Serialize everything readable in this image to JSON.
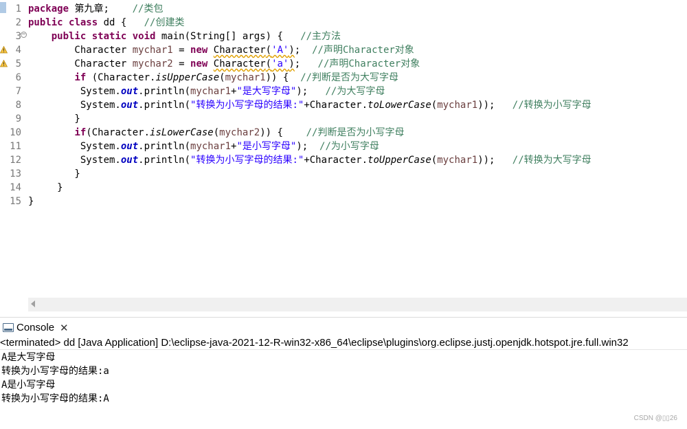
{
  "editor": {
    "line_numbers": [
      "1",
      "2",
      "3",
      "4",
      "5",
      "6",
      "7",
      "8",
      "9",
      "10",
      "11",
      "12",
      "13",
      "14",
      "15"
    ],
    "lines": [
      [
        {
          "c": "kw",
          "t": "package"
        },
        {
          "t": " 第九章;    "
        },
        {
          "c": "cm",
          "t": "//类包"
        }
      ],
      [
        {
          "c": "kw",
          "t": "public"
        },
        {
          "t": " "
        },
        {
          "c": "kw",
          "t": "class"
        },
        {
          "t": " dd {   "
        },
        {
          "c": "cm",
          "t": "//创建类"
        }
      ],
      [
        {
          "t": "    "
        },
        {
          "c": "kw",
          "t": "public"
        },
        {
          "t": " "
        },
        {
          "c": "kw",
          "t": "static"
        },
        {
          "t": " "
        },
        {
          "c": "kw",
          "t": "void"
        },
        {
          "t": " main(String[] args) {   "
        },
        {
          "c": "cm",
          "t": "//主方法"
        }
      ],
      [
        {
          "t": "        Character "
        },
        {
          "c": "va",
          "t": "mychar1"
        },
        {
          "t": " = "
        },
        {
          "c": "kw",
          "t": "new"
        },
        {
          "t": " "
        },
        {
          "c": "dep squig",
          "t": "Character"
        },
        {
          "c": "squig",
          "t": "("
        },
        {
          "c": "st squig",
          "t": "'A'"
        },
        {
          "c": "squig",
          "t": ")"
        },
        {
          "t": ";  "
        },
        {
          "c": "cm",
          "t": "//声明Character对象"
        }
      ],
      [
        {
          "t": "        Character "
        },
        {
          "c": "va",
          "t": "mychar2"
        },
        {
          "t": " = "
        },
        {
          "c": "kw",
          "t": "new"
        },
        {
          "t": " "
        },
        {
          "c": "dep squig",
          "t": "Character"
        },
        {
          "c": "squig",
          "t": "("
        },
        {
          "c": "st squig",
          "t": "'a'"
        },
        {
          "c": "squig",
          "t": ")"
        },
        {
          "t": ";   "
        },
        {
          "c": "cm",
          "t": "//声明Character对象"
        }
      ],
      [
        {
          "t": "        "
        },
        {
          "c": "kw",
          "t": "if"
        },
        {
          "t": " (Character."
        },
        {
          "c": "it",
          "t": "isUpperCase"
        },
        {
          "t": "("
        },
        {
          "c": "va",
          "t": "mychar1"
        },
        {
          "t": ")) {  "
        },
        {
          "c": "cm",
          "t": "//判断是否为大写字母"
        }
      ],
      [
        {
          "t": "         System."
        },
        {
          "c": "fd",
          "t": "out"
        },
        {
          "t": ".println("
        },
        {
          "c": "va",
          "t": "mychar1"
        },
        {
          "t": "+"
        },
        {
          "c": "st",
          "t": "\"是大写字母\""
        },
        {
          "t": ");   "
        },
        {
          "c": "cm",
          "t": "//为大写字母"
        }
      ],
      [
        {
          "t": "         System."
        },
        {
          "c": "fd",
          "t": "out"
        },
        {
          "t": ".println("
        },
        {
          "c": "st",
          "t": "\"转换为小写字母的结果:\""
        },
        {
          "t": "+Character."
        },
        {
          "c": "it",
          "t": "toLowerCase"
        },
        {
          "t": "("
        },
        {
          "c": "va",
          "t": "mychar1"
        },
        {
          "t": "));   "
        },
        {
          "c": "cm",
          "t": "//转换为小写字母"
        }
      ],
      [
        {
          "t": "        }"
        }
      ],
      [
        {
          "t": "        "
        },
        {
          "c": "kw",
          "t": "if"
        },
        {
          "t": "(Character."
        },
        {
          "c": "it",
          "t": "isLowerCase"
        },
        {
          "t": "("
        },
        {
          "c": "va",
          "t": "mychar2"
        },
        {
          "t": ")) {    "
        },
        {
          "c": "cm",
          "t": "//判断是否为小写字母"
        }
      ],
      [
        {
          "t": "         System."
        },
        {
          "c": "fd",
          "t": "out"
        },
        {
          "t": ".println("
        },
        {
          "c": "va",
          "t": "mychar1"
        },
        {
          "t": "+"
        },
        {
          "c": "st",
          "t": "\"是小写字母\""
        },
        {
          "t": ");  "
        },
        {
          "c": "cm",
          "t": "//为小写字母"
        }
      ],
      [
        {
          "t": "         System."
        },
        {
          "c": "fd",
          "t": "out"
        },
        {
          "t": ".println("
        },
        {
          "c": "st",
          "t": "\"转换为小写字母的结果:\""
        },
        {
          "t": "+Character."
        },
        {
          "c": "it",
          "t": "toUpperCase"
        },
        {
          "t": "("
        },
        {
          "c": "va",
          "t": "mychar1"
        },
        {
          "t": "));   "
        },
        {
          "c": "cm",
          "t": "//转换为大写字母"
        }
      ],
      [
        {
          "t": "        }"
        }
      ],
      [
        {
          "t": "     }"
        }
      ],
      [
        {
          "t": "}"
        }
      ]
    ]
  },
  "console": {
    "tab_label": "Console",
    "close_glyph": "✕",
    "terminated_line": "<terminated> dd [Java Application] D:\\eclipse-java-2021-12-R-win32-x86_64\\eclipse\\plugins\\org.eclipse.justj.openjdk.hotspot.jre.full.win32",
    "output": [
      "A是大写字母",
      "转换为小写字母的结果:a",
      "A是小写字母",
      "转换为小写字母的结果:A"
    ]
  },
  "watermark": "CSDN @▯▯26",
  "colors": {
    "keyword": "#7f0055",
    "comment": "#3f7f5f",
    "string": "#2a00ff",
    "local_variable": "#6a3e3e",
    "static_field": "#0000c0"
  }
}
